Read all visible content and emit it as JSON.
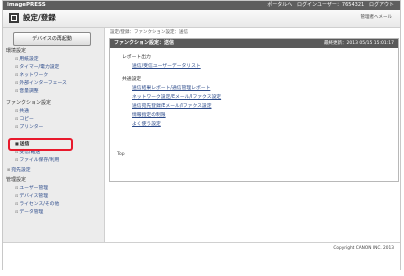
{
  "header": {
    "brand": "imagePRESS",
    "portal_label": "ポータルへ",
    "login_user": "ログインユーザー：7654321",
    "logout_label": "ログアウト",
    "page_title": "設定/登録",
    "admin_mail": "管理者へメール"
  },
  "sidebar": {
    "restart_label": "デバイスの再起動",
    "sections": [
      {
        "title": "環境設定",
        "items": [
          "用紙設定",
          "タイマー/電力設定",
          "ネットワーク",
          "外部インターフェース",
          "音量調整"
        ]
      },
      {
        "title": "ファンクション設定",
        "items": [
          "共通",
          "コピー",
          "プリンター",
          "送信",
          "受信/転送",
          "ファイル保存/利用"
        ]
      },
      {
        "title": "宛先設定",
        "items": []
      },
      {
        "title": "管理設定",
        "items": [
          "ユーザー管理",
          "デバイス管理",
          "ライセンス/その他",
          "データ管理"
        ]
      }
    ],
    "selected_item": "送信"
  },
  "main": {
    "breadcrumb": "設定/登録：ファンクション設定：送信",
    "panel_title": "ファンクション設定：送信",
    "last_updated": "最終更新：2013 05/15 15:01:17",
    "report_output_label": "レポート出力",
    "report_links": [
      "送信/受信ユーザーデータリスト"
    ],
    "common_settings_label": "共通設定",
    "common_links": [
      "送信結果レポート/通信管理レポート",
      "ネットワーク設定/Eメール/Iファクス設定",
      "送信宛先登録/Eメール/Iファクス設定",
      "情報指定の制限",
      "よく使う設定"
    ],
    "top_link": "Top"
  },
  "footer": {
    "copyright": "Copyright CANON INC. 2013"
  },
  "colors": {
    "topbar": "#5e5e5e",
    "highlight": "#e8192c",
    "link": "#2b4a8a"
  }
}
